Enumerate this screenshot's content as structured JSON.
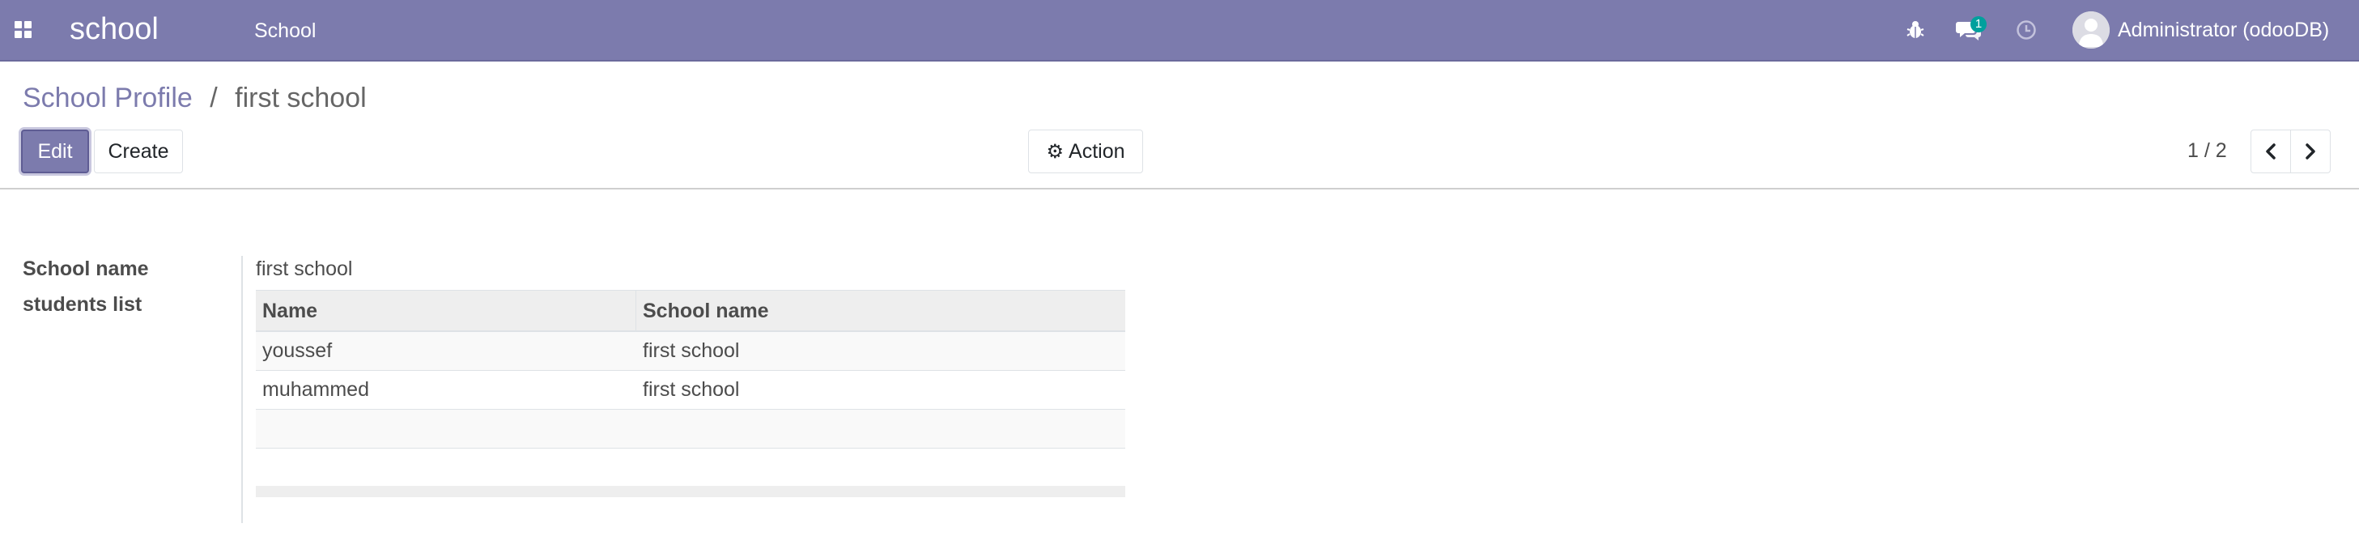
{
  "navbar": {
    "brand": "school",
    "menu_item": "School",
    "messages_badge": "1",
    "user_name": "Administrator (odooDB)",
    "icons": [
      "apps-icon",
      "bug-icon",
      "chat-icon",
      "clock-icon",
      "avatar"
    ]
  },
  "breadcrumb": {
    "parent": "School Profile",
    "separator": "/",
    "current": "first school"
  },
  "toolbar": {
    "edit_label": "Edit",
    "create_label": "Create",
    "action_label": "Action"
  },
  "pager": {
    "value": "1 / 2"
  },
  "form": {
    "school_name_label": "School name",
    "school_name_value": "first school",
    "students_label": "students list",
    "students_table": {
      "headers": [
        "Name",
        "School name"
      ],
      "rows": [
        [
          "youssef",
          "first school"
        ],
        [
          "muhammed",
          "first school"
        ]
      ]
    }
  },
  "colors": {
    "navbar": "#7c7bad",
    "primary_button": "#7c7bad",
    "badge": "#00a09d",
    "link": "#7c7bad"
  }
}
